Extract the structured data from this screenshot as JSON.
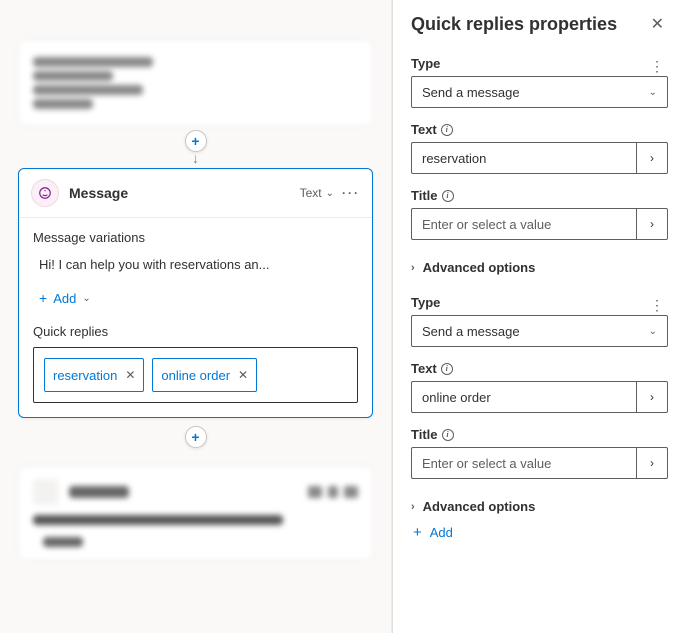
{
  "panel": {
    "title": "Quick replies properties",
    "replies": [
      {
        "type_label": "Type",
        "type_value": "Send a message",
        "text_label": "Text",
        "text_value": "reservation",
        "title_label": "Title",
        "title_placeholder": "Enter or select a value",
        "advanced_label": "Advanced options"
      },
      {
        "type_label": "Type",
        "type_value": "Send a message",
        "text_label": "Text",
        "text_value": "online order",
        "title_label": "Title",
        "title_placeholder": "Enter or select a value",
        "advanced_label": "Advanced options"
      }
    ],
    "add_label": "Add"
  },
  "canvas": {
    "message_node": {
      "title": "Message",
      "type_menu": "Text",
      "variations_label": "Message variations",
      "variation_text": "Hi! I can help you with reservations an...",
      "add_label": "Add",
      "quick_replies_label": "Quick replies",
      "chips": [
        "reservation",
        "online order"
      ]
    }
  }
}
